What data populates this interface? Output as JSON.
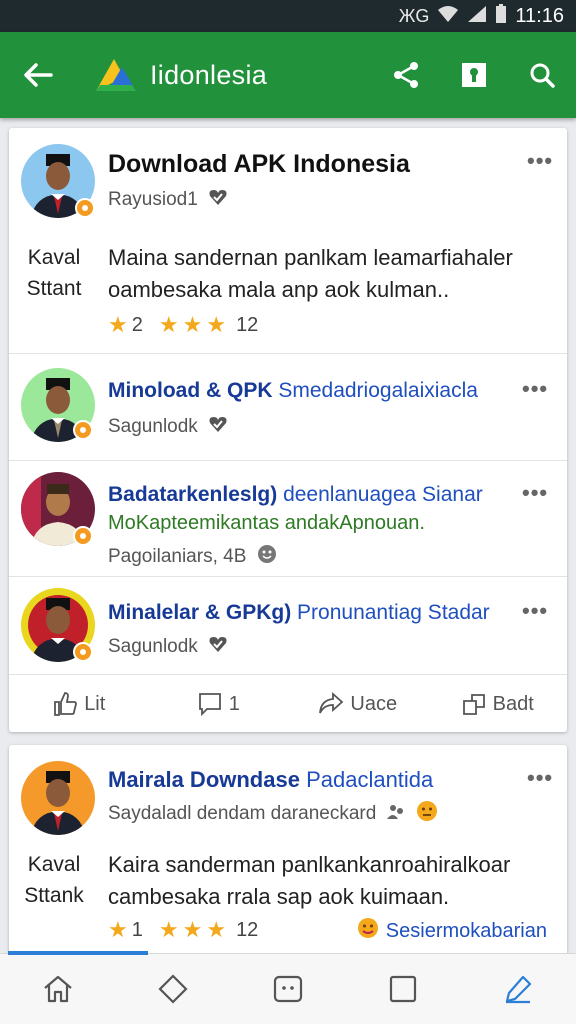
{
  "status_bar": {
    "network": "ЖG",
    "time": "11:16"
  },
  "app_bar": {
    "title": "Iidonlesia",
    "icons": [
      "back-arrow-icon",
      "share-icon",
      "keyhole-icon",
      "search-icon"
    ]
  },
  "card1": {
    "title": "Download APK Indonesia",
    "author": "Rayusiod1",
    "side_label_1": "Kaval",
    "side_label_2": "Sttant",
    "body_line_1": "Maina sandernan panlkam leamarfiahaler",
    "body_line_2": "oambesaka mala anp aok kulman..",
    "rating_a": "2",
    "rating_b": "12",
    "more": "•••",
    "rows": [
      {
        "title_bold": "Minoload & QPK",
        "title_rest": " Smedadriogalaixiacla",
        "sub": "",
        "meta": "Sagunlodk"
      },
      {
        "title_bold": "Badatarkenleslg)",
        "title_rest": " deenlanuagea Sianar",
        "sub": "MoKapteemikantas andakApnouan.",
        "meta": "Pagoilaniars, 4B"
      },
      {
        "title_bold": "Minalelar & GPKg)",
        "title_rest": " Pronunantiag Stadar",
        "sub": "",
        "meta": "Sagunlodk"
      }
    ],
    "actions": [
      {
        "label": "Lit",
        "icon": "like-icon"
      },
      {
        "label": "1",
        "icon": "comment-icon"
      },
      {
        "label": "Uace",
        "icon": "share-arrow-icon"
      },
      {
        "label": "Badt",
        "icon": "repost-icon"
      }
    ]
  },
  "card2": {
    "title_bold": "Mairala Downdase",
    "title_rest": " Padaclantida",
    "meta": "Saydaladl  dendam daraneckard",
    "side_label_1": "Kaval",
    "side_label_2": "Sttank",
    "body_line_1": "Kaira sanderman panlkankanroahiralkoar",
    "body_line_2": "cambesaka rrala sap aok kuimaan.",
    "rating_a": "1",
    "rating_b": "12",
    "reaction": "Sesiermokabarian",
    "more": "•••"
  },
  "colors": {
    "app_bar": "#21913b",
    "link": "#1f4fbf",
    "star": "#f4a81c",
    "badge": "#f39a1f",
    "nav_active": "#2c7fd6"
  },
  "bottom_nav": [
    "home-icon",
    "diamond-icon",
    "game-icon",
    "square-icon",
    "edit-icon"
  ]
}
